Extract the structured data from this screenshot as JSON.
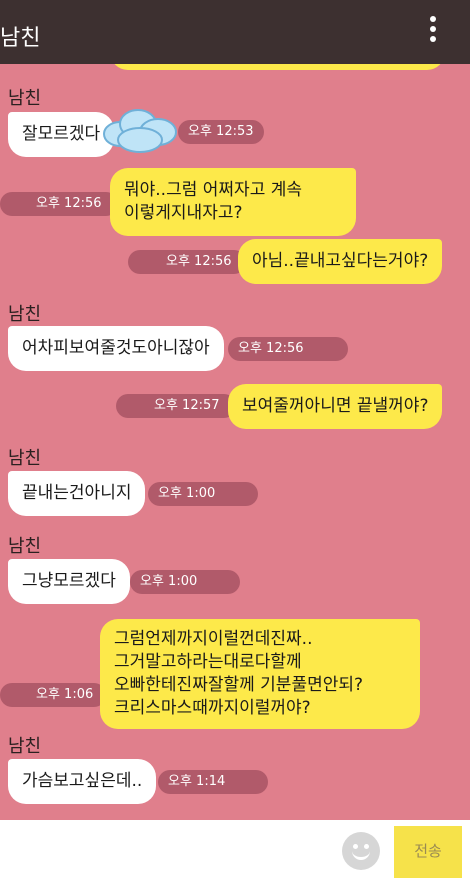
{
  "header": {
    "title": "남친"
  },
  "messages": [
    {
      "sender": "남친",
      "text": "잘모르겠다",
      "time": "오후 12:53"
    },
    {
      "text_lines": [
        "뭐야..그럼 어쩌자고 계속",
        "이렇게지내자고?"
      ],
      "time": "오후 12:56"
    },
    {
      "text": "아님..끝내고싶다는거야?",
      "time": "오후 12:56"
    },
    {
      "sender": "남친",
      "text": "어차피보여줄것도아니잖아",
      "time": "오후 12:56"
    },
    {
      "text": "보여줄꺼아니면 끝낼꺼야?",
      "time": "오후 12:57"
    },
    {
      "sender": "남친",
      "text": "끝내는건아니지",
      "time": "오후 1:00"
    },
    {
      "sender": "남친",
      "text": "그냥모르겠다",
      "time": "오후 1:00"
    },
    {
      "text_lines": [
        "그럼언제까지이럴껀데진짜..",
        "그거말고하라는대로다할께",
        "오빠한테진짜잘할께 기분풀면안되?",
        "크리스마스때까지이럴꺼야?"
      ],
      "time": "오후 1:06"
    },
    {
      "sender": "남친",
      "text": "가슴보고싶은데..",
      "time": "오후 1:14"
    }
  ],
  "input": {
    "send_label": "전송",
    "emoji_icon": "smiley-icon"
  },
  "colors": {
    "background": "#e07f8c",
    "topbar": "#3d3030",
    "outgoing": "#fde94a",
    "incoming": "#ffffff",
    "time_pill": "#b15a6a"
  }
}
